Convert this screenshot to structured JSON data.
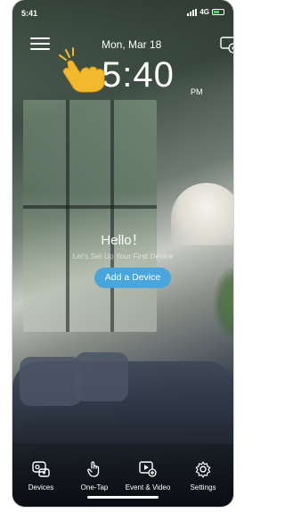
{
  "status_bar": {
    "time": "5:41",
    "network": "4G"
  },
  "header": {
    "date": "Mon, Mar 18",
    "time": "5:40",
    "ampm": "PM"
  },
  "welcome": {
    "title": "Hello！",
    "subtitle": "Let's Set Up Your First Device",
    "add_button": "Add a Device"
  },
  "nav": {
    "tabs": [
      {
        "label": "Devices",
        "icon": "devices-icon"
      },
      {
        "label": "One-Tap",
        "icon": "tap-icon"
      },
      {
        "label": "Event & Video",
        "icon": "event-video-icon"
      },
      {
        "label": "Settings",
        "icon": "gear-icon"
      }
    ]
  },
  "colors": {
    "accent": "#48a6dc",
    "hand": "#f2b82e"
  }
}
